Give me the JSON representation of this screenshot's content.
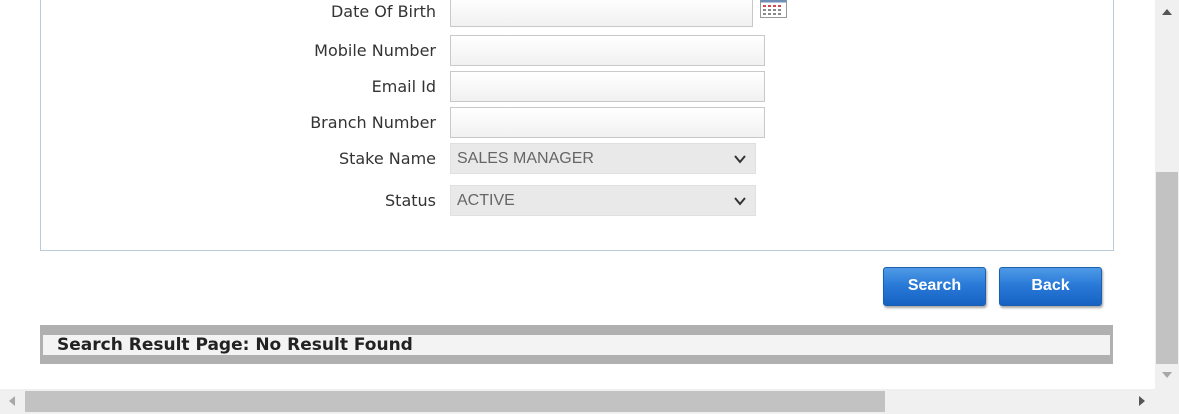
{
  "form": {
    "date_of_birth_label": "Date Of Birth",
    "mobile_number_label": "Mobile Number",
    "email_id_label": "Email Id",
    "branch_number_label": "Branch Number",
    "stake_name_label": "Stake Name",
    "stake_name_value": "SALES MANAGER",
    "status_label": "Status",
    "status_value": "ACTIVE"
  },
  "actions": {
    "search_label": "Search",
    "back_label": "Back"
  },
  "result": {
    "message": "Search Result Page: No Result Found"
  },
  "icons": {
    "calendar": "calendar-icon",
    "chevron": "chevron-down-icon"
  },
  "colors": {
    "button_blue": "#1f6fd0",
    "panel_border": "#b9cbd8",
    "result_bar": "#b0b0b0"
  }
}
